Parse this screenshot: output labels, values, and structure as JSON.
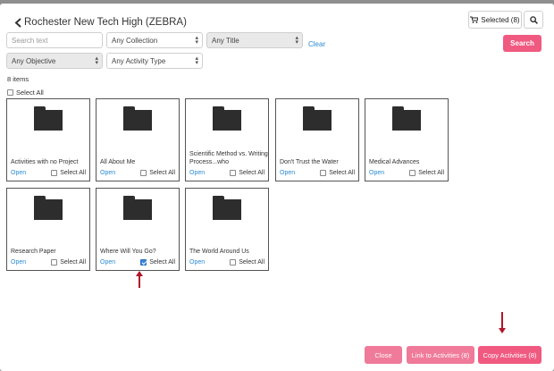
{
  "header": {
    "title": "Rochester New Tech High (ZEBRA)",
    "selected_label": "Selected (8)"
  },
  "filters": {
    "search_placeholder": "Search text",
    "collection": "Any Collection",
    "title": "Any Title",
    "clear": "Clear",
    "search_button": "Search",
    "objective": "Any Objective",
    "activity_type": "Any Activity Type"
  },
  "results": {
    "count_text": "8 items",
    "select_all": "Select All"
  },
  "cards": [
    {
      "name": "Activities with no Project",
      "open": "Open",
      "select": "Select All",
      "checked": false
    },
    {
      "name": "All About Me",
      "open": "Open",
      "select": "Select All",
      "checked": false
    },
    {
      "name": "Scientific Method vs. Writing Process...who",
      "open": "Open",
      "select": "Select All",
      "checked": false
    },
    {
      "name": "Don't Trust the Water",
      "open": "Open",
      "select": "Select All",
      "checked": false
    },
    {
      "name": "Medical Advances",
      "open": "Open",
      "select": "Select All",
      "checked": false
    },
    {
      "name": "Research Paper",
      "open": "Open",
      "select": "Select All",
      "checked": false
    },
    {
      "name": "Where Will You Go?",
      "open": "Open",
      "select": "Select All",
      "checked": true
    },
    {
      "name": "The World Around Us",
      "open": "Open",
      "select": "Select All",
      "checked": false
    }
  ],
  "footer": {
    "close": "Close",
    "link": "Link to Activities (8)",
    "copy": "Copy Activities (8)"
  },
  "colors": {
    "accent": "#f05a80",
    "accent_light": "#f07a99",
    "link": "#2a8bd4",
    "annotation_arrow": "#b0142b"
  }
}
